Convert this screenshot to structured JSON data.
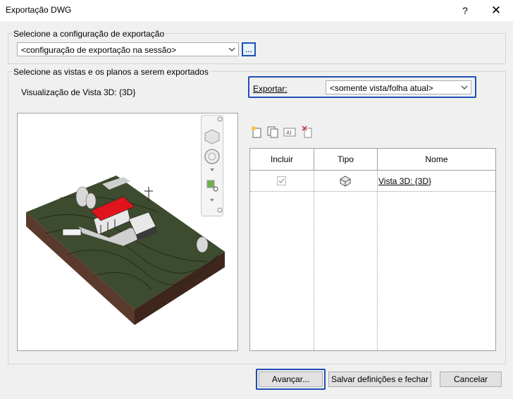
{
  "window": {
    "title": "Exportação DWG",
    "help_glyph": "?",
    "close_glyph": "✕"
  },
  "config_group": {
    "label": "Selecione a configuração de exportação",
    "combo_value": "<configuração de exportação na sessão>",
    "browse_label": "..."
  },
  "views_group": {
    "label": "Selecione as vistas e os planos a serem exportados",
    "preview_label": "Visualização de Vista 3D: {3D}",
    "export_label": "Exportar:",
    "export_value": "<somente vista/folha atual>"
  },
  "toolbar_icons": [
    "new-set-icon",
    "duplicate-set-icon",
    "rename-set-icon",
    "delete-set-icon"
  ],
  "grid": {
    "columns": [
      "Incluir",
      "Tipo",
      "Nome"
    ],
    "rows": [
      {
        "include": true,
        "type_icon": "3d-view-icon",
        "name": "Vista 3D: {3D}"
      }
    ]
  },
  "buttons": {
    "next": "Avançar...",
    "save_close": "Salvar definições e fechar",
    "cancel": "Cancelar"
  },
  "colors": {
    "focus": "#1f4fb4",
    "roof": "#e0141c",
    "terrain": "#3b4a2c",
    "soil": "#4a2e22"
  }
}
